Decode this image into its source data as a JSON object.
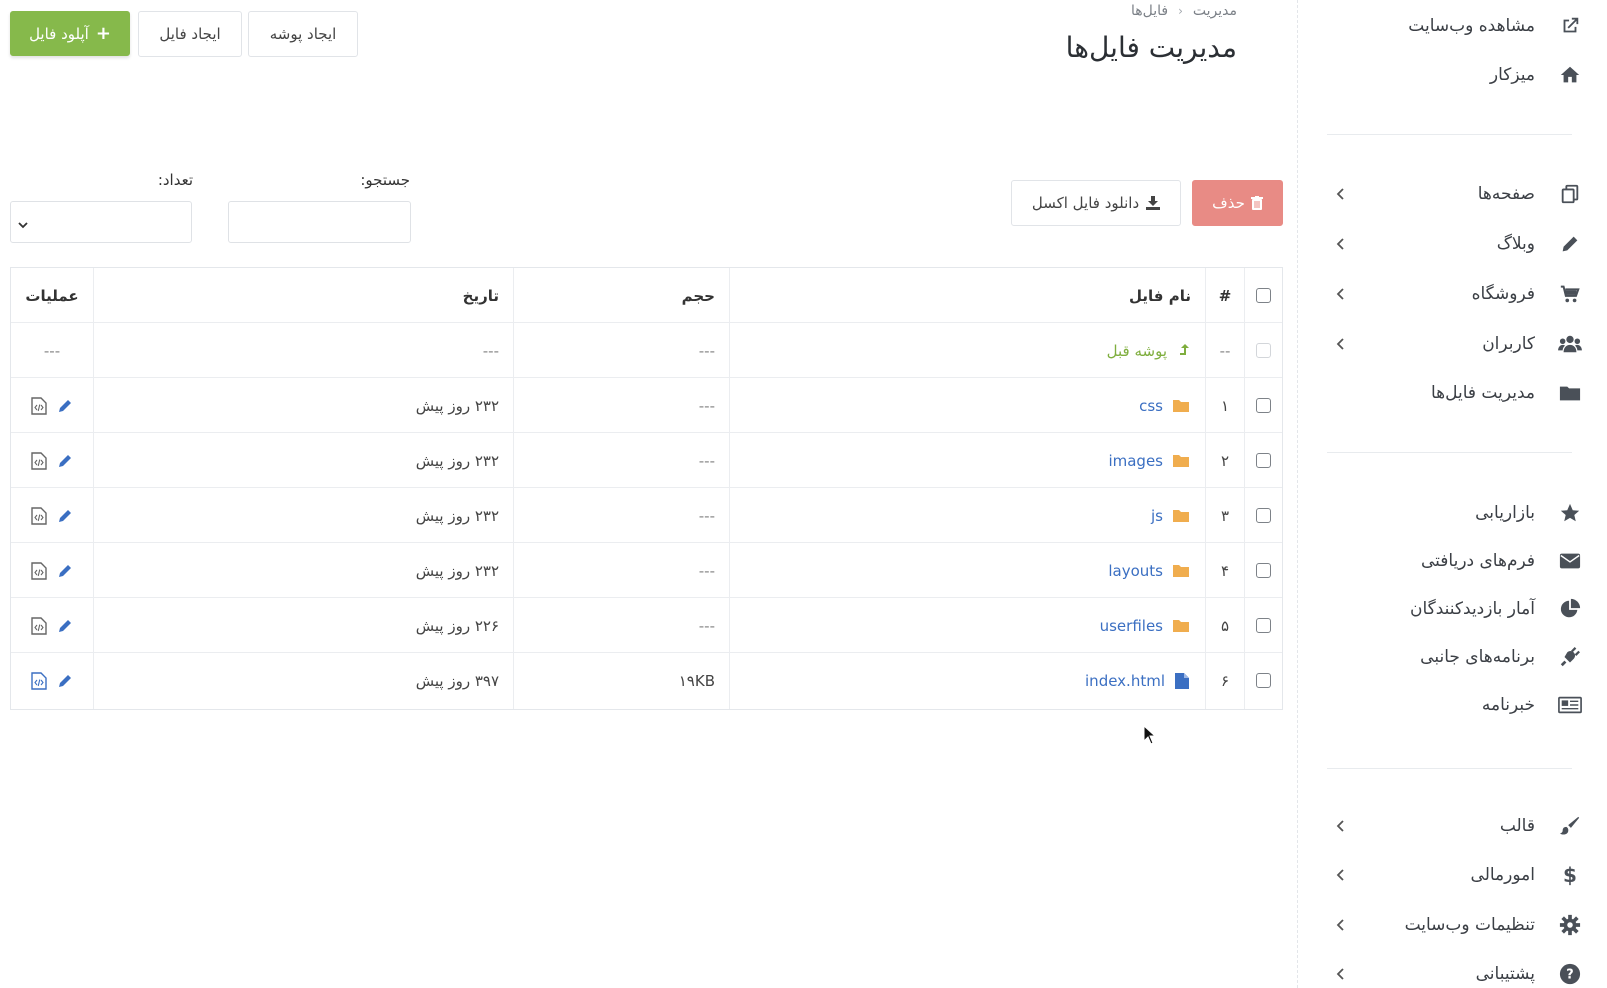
{
  "header": {
    "breadcrumb": [
      "مدیریت",
      "فایل‌ها"
    ],
    "breadcrumb_sep": "‹",
    "title": "مدیریت فایل‌ها"
  },
  "toolbar": {
    "upload_label": "آپلود فایل",
    "create_file_label": "ایجاد فایل",
    "create_folder_label": "ایجاد پوشه"
  },
  "actions": {
    "delete_label": "حذف",
    "excel_label": "دانلود فایل اکسل"
  },
  "filters": {
    "search_label": "جستجو:",
    "count_label": "تعداد:",
    "search_value": "",
    "count_value": ""
  },
  "table": {
    "headers": {
      "num": "#",
      "name": "نام فایل",
      "size": "حجم",
      "date": "تاریخ",
      "ops": "عملیات"
    },
    "parent_row": {
      "num": "--",
      "name": "پوشه قبل",
      "size": "---",
      "date": "---",
      "ops": "---"
    },
    "rows": [
      {
        "num": "۱",
        "name": "css",
        "type": "folder",
        "size": "---",
        "date": "۲۳۲ روز پیش"
      },
      {
        "num": "۲",
        "name": "images",
        "type": "folder",
        "size": "---",
        "date": "۲۳۲ روز پیش"
      },
      {
        "num": "۳",
        "name": "js",
        "type": "folder",
        "size": "---",
        "date": "۲۳۲ روز پیش"
      },
      {
        "num": "۴",
        "name": "layouts",
        "type": "folder",
        "size": "---",
        "date": "۲۳۲ روز پیش"
      },
      {
        "num": "۵",
        "name": "userfiles",
        "type": "folder",
        "size": "---",
        "date": "۲۲۶ روز پیش"
      },
      {
        "num": "۶",
        "name": "index.html",
        "type": "file",
        "size": "۱۹KB",
        "date": "۳۹۷ روز پیش"
      }
    ]
  },
  "sidebar": {
    "items": [
      {
        "label": "مشاهده وب‌سایت",
        "icon": "external-link-icon"
      },
      {
        "label": "میزکار",
        "icon": "home-icon"
      },
      {
        "label": "صفحه‌ها",
        "icon": "pages-icon"
      },
      {
        "label": "وبلاگ",
        "icon": "pencil-icon"
      },
      {
        "label": "فروشگاه",
        "icon": "cart-icon"
      },
      {
        "label": "کاربران",
        "icon": "users-icon"
      },
      {
        "label": "مدیریت فایل‌ها",
        "icon": "folder-icon"
      },
      {
        "label": "بازاریابی",
        "icon": "star-icon"
      },
      {
        "label": "فرم‌های دریافتی",
        "icon": "envelope-icon"
      },
      {
        "label": "آمار بازدیدکنندگان",
        "icon": "pie-chart-icon"
      },
      {
        "label": "برنامه‌های جانبی",
        "icon": "plug-icon"
      },
      {
        "label": "خبرنامه",
        "icon": "newspaper-icon"
      },
      {
        "label": "قالب",
        "icon": "paintbrush-icon"
      },
      {
        "label": "امورمالی",
        "icon": "dollar-icon"
      },
      {
        "label": "تنظیمات وب‌سایت",
        "icon": "gear-icon"
      },
      {
        "label": "پشتیبانی",
        "icon": "question-icon"
      }
    ]
  },
  "colors": {
    "accent_green": "#86b94b",
    "danger": "#e88b85",
    "link": "#3b6fc2",
    "folder": "#f0ad4e",
    "sidebar_icon": "#4a5058"
  }
}
